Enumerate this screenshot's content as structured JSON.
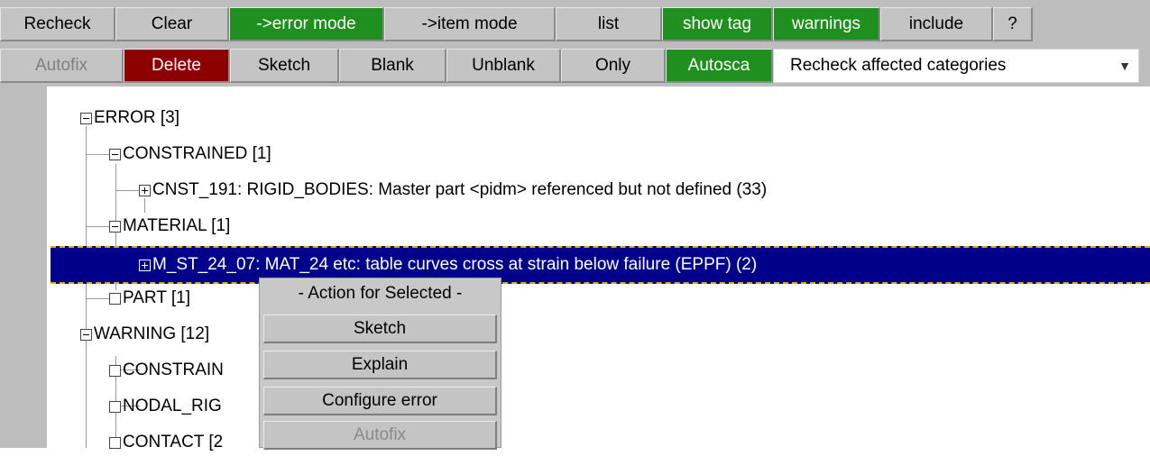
{
  "toolbar_row1": [
    {
      "label": "Recheck",
      "style": "normal"
    },
    {
      "label": "Clear",
      "style": "normal"
    },
    {
      "label": "->error mode",
      "style": "green"
    },
    {
      "label": "->item mode",
      "style": "normal"
    },
    {
      "label": "list",
      "style": "normal"
    },
    {
      "label": "show tag",
      "style": "green"
    },
    {
      "label": "warnings",
      "style": "green"
    },
    {
      "label": "include",
      "style": "normal"
    },
    {
      "label": "?",
      "style": "normal"
    }
  ],
  "toolbar_row2": [
    {
      "label": "Autofix",
      "style": "disabled"
    },
    {
      "label": "Delete",
      "style": "red"
    },
    {
      "label": "Sketch",
      "style": "normal"
    },
    {
      "label": "Blank",
      "style": "normal"
    },
    {
      "label": "Unblank",
      "style": "normal"
    },
    {
      "label": "Only",
      "style": "normal"
    },
    {
      "label": "Autosca",
      "style": "green"
    }
  ],
  "dropdown": {
    "value": "Recheck affected categories",
    "arrow": "▼"
  },
  "tree": {
    "error": "ERROR [3]",
    "constrained": "CONSTRAINED [1]",
    "cnst_item": "CNST_191: RIGID_BODIES: Master part <pidm> referenced but not defined (33)",
    "material": "MATERIAL [1]",
    "mat_item": "M_ST_24_07: MAT_24 etc: table curves cross at strain below failure (EPPF) (2)",
    "part": "PART [1]",
    "warning": "WARNING [12]",
    "constrain": "CONSTRAIN",
    "nodal_rig": "NODAL_RIG",
    "contact": "CONTACT [2"
  },
  "context_menu": {
    "title": "- Action for Selected -",
    "items": [
      {
        "label": "Sketch",
        "enabled": true
      },
      {
        "label": "Explain",
        "enabled": true
      },
      {
        "label": "Configure error",
        "enabled": true
      },
      {
        "label": "Autofix",
        "enabled": false
      }
    ]
  },
  "colors": {
    "green": "#1f8f1f",
    "red": "#8c0000",
    "selection": "#00008b",
    "button": "#c4c4c4"
  }
}
